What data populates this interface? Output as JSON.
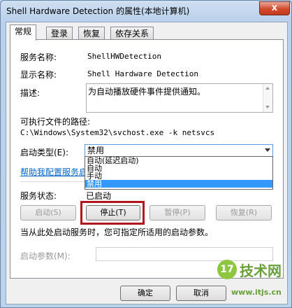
{
  "window": {
    "title": "Shell Hardware Detection 的属性(本地计算机)",
    "close_label": "x"
  },
  "tabs": [
    {
      "label": "常规",
      "active": true
    },
    {
      "label": "登录",
      "active": false
    },
    {
      "label": "恢复",
      "active": false
    },
    {
      "label": "依存关系",
      "active": false
    }
  ],
  "general": {
    "service_name_label": "服务名称:",
    "service_name_value": "ShellHWDetection",
    "display_name_label": "显示名称:",
    "display_name_value": "Shell Hardware Detection",
    "description_label": "描述:",
    "description_value": "为自动播放硬件事件提供通知。",
    "path_label": "可执行文件的路径:",
    "path_value": "C:\\Windows\\System32\\svchost.exe -k netsvcs",
    "startup_type_label": "启动类型(E):",
    "startup_type_value": "禁用",
    "startup_options": [
      {
        "label": "自动(延迟启动)",
        "selected": false
      },
      {
        "label": "自动",
        "selected": false
      },
      {
        "label": "手动",
        "selected": false
      },
      {
        "label": "禁用",
        "selected": true
      }
    ],
    "help_link": "帮助我配置服务启",
    "status_label": "服务状态:",
    "status_value": "已启动",
    "buttons": {
      "start": "启动(S)",
      "stop": "停止(T)",
      "pause": "暂停(P)",
      "resume": "恢复(R)"
    },
    "hint": "当从此处启动服务时，您可指定所适用的启动参数。",
    "start_params_label": "启动参数(M):",
    "start_params_value": ""
  },
  "footer": {
    "ok": "确定",
    "cancel": "取消"
  },
  "watermark": {
    "logo": "17",
    "text": "技术网",
    "url": "www.itjs.cn"
  },
  "colors": {
    "highlight_border": "#b0161b",
    "selection": "#3399ff",
    "link": "#0066cc"
  }
}
